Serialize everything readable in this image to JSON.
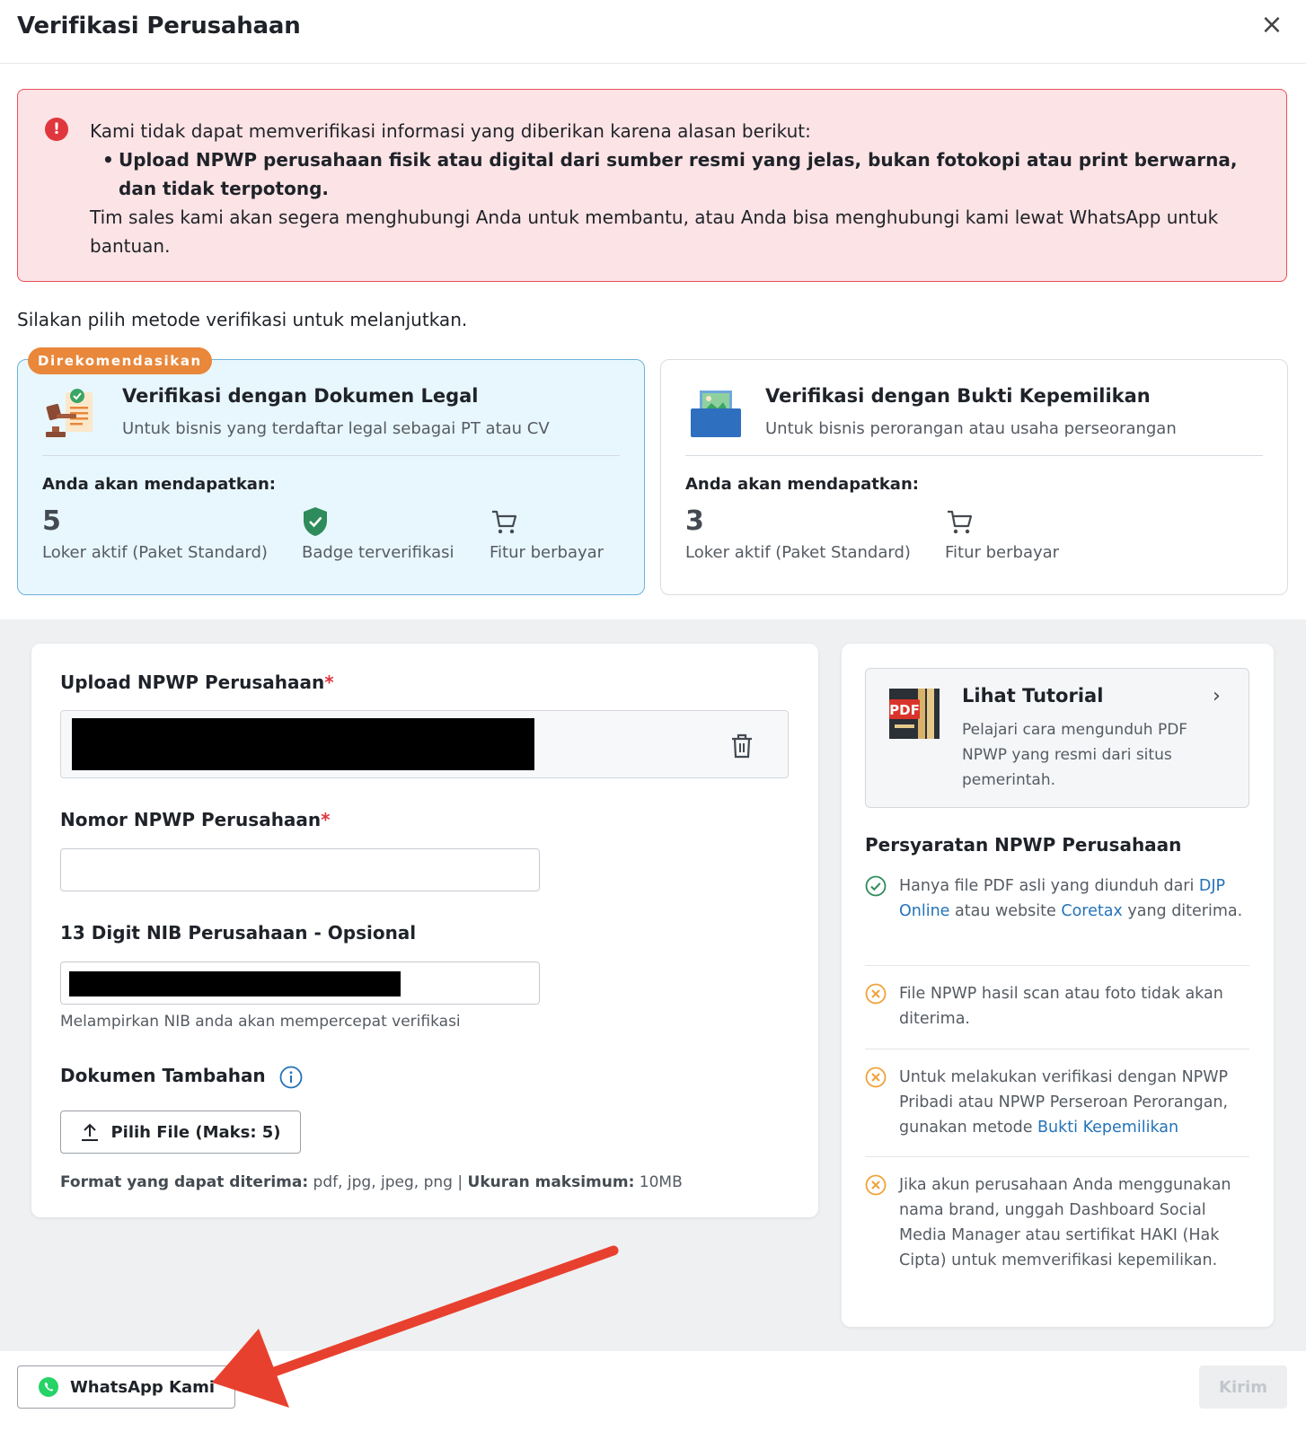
{
  "header": {
    "title": "Verifikasi Perusahaan",
    "close_icon": "close-icon"
  },
  "alert": {
    "icon": "exclamation-circle-icon",
    "intro": "Kami tidak dapat memverifikasi informasi yang diberikan karena alasan berikut:",
    "reason": "Upload NPWP perusahaan fisik atau digital dari sumber resmi yang jelas, bukan fotokopi atau print berwarna, dan tidak terpotong.",
    "footer": "Tim sales kami akan segera menghubungi Anda untuk membantu, atau Anda bisa menghubungi kami lewat WhatsApp untuk bantuan."
  },
  "choose_text": "Silakan pilih metode verifikasi untuk melanjutkan.",
  "methods": {
    "legal": {
      "badge": "Direkomendasikan",
      "title": "Verifikasi dengan Dokumen Legal",
      "subtitle": "Untuk bisnis yang terdaftar legal sebagai PT atau CV",
      "get_label": "Anda akan mendapatkan:",
      "jobs_count": "5",
      "jobs_label": "Loker aktif (Paket Standard)",
      "badge_label": "Badge terverifikasi",
      "paid_label": "Fitur berbayar",
      "selected": true
    },
    "ownership": {
      "title": "Verifikasi dengan Bukti Kepemilikan",
      "subtitle": "Untuk bisnis perorangan atau usaha perseorangan",
      "get_label": "Anda akan mendapatkan:",
      "jobs_count": "3",
      "jobs_label": "Loker aktif (Paket Standard)",
      "paid_label": "Fitur berbayar",
      "selected": false
    }
  },
  "form": {
    "npwp_upload_label": "Upload NPWP Perusahaan",
    "npwp_number_label": "Nomor NPWP Perusahaan",
    "npwp_number_value": "",
    "nib_label": "13 Digit NIB Perusahaan - Opsional",
    "nib_hint": "Melampirkan NIB anda akan mempercepat verifikasi",
    "extra_docs_label": "Dokumen Tambahan",
    "pick_file_button": "Pilih File (Maks: 5)",
    "format_label": "Format yang dapat diterima:",
    "format_value": "pdf, jpg, jpeg, png",
    "separator": "|",
    "size_label": "Ukuran maksimum:",
    "size_value": "10MB",
    "required_mark": "*"
  },
  "tutorial": {
    "title": "Lihat Tutorial",
    "description": "Pelajari cara mengunduh PDF NPWP yang resmi dari situs pemerintah."
  },
  "requirements": {
    "title": "Persyaratan NPWP Perusahaan",
    "items": [
      {
        "status": "ok",
        "parts": [
          "Hanya file PDF asli yang diunduh dari ",
          "DJP Online",
          " atau website ",
          "Coretax",
          " yang diterima."
        ]
      },
      {
        "status": "no",
        "text": "File NPWP hasil scan atau foto tidak akan diterima."
      },
      {
        "status": "no",
        "parts": [
          "Untuk melakukan verifikasi dengan NPWP Pribadi atau NPWP Perseroan Perorangan, gunakan metode ",
          "Bukti Kepemilikan"
        ]
      },
      {
        "status": "no",
        "text": "Jika akun perusahaan Anda menggunakan nama brand, unggah Dashboard Social Media Manager atau sertifikat HAKI (Hak Cipta) untuk memverifikasi kepemilikan."
      }
    ]
  },
  "footer": {
    "whatsapp_button": "WhatsApp Kami",
    "send_button": "Kirim"
  },
  "colors": {
    "accent_link": "#2473b8",
    "alert_bg": "#fce3e5",
    "alert_border": "#e9505a",
    "badge": "#e9873a",
    "check_green": "#2e8b5b",
    "cross_orange": "#f0a23a",
    "arrow_red": "#e8402e"
  }
}
